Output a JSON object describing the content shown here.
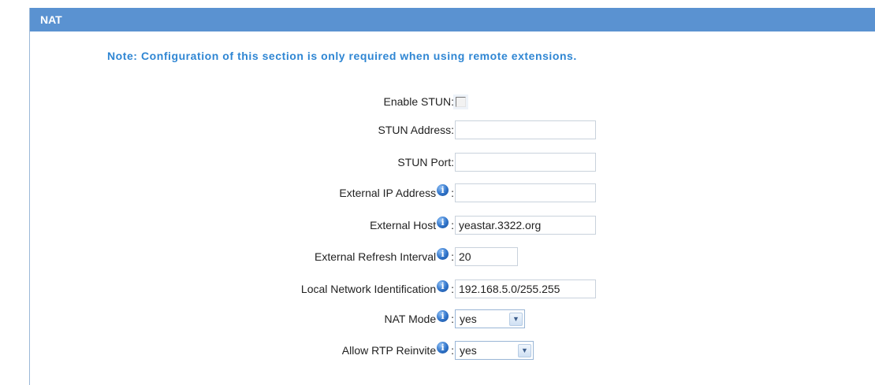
{
  "header": {
    "title": "NAT"
  },
  "note": "Note: Configuration of this section is only required when using remote extensions.",
  "form": {
    "enable_stun": {
      "label": "Enable STUN:",
      "checked": false
    },
    "stun_address": {
      "label": "STUN Address:",
      "value": ""
    },
    "stun_port": {
      "label": "STUN Port:",
      "value": ""
    },
    "external_ip": {
      "label": "External IP Address",
      "value": ""
    },
    "external_host": {
      "label": "External Host",
      "value": "yeastar.3322.org"
    },
    "external_refresh": {
      "label": "External Refresh Interval",
      "value": "20"
    },
    "local_network": {
      "label": "Local Network Identification",
      "value": "192.168.5.0/255.255"
    },
    "nat_mode": {
      "label": "NAT Mode",
      "selected": "yes"
    },
    "allow_rtp": {
      "label": "Allow RTP Reinvite",
      "selected": "yes"
    }
  },
  "icons": {
    "info": "info-icon",
    "dropdown": "chevron-down-icon"
  },
  "colors": {
    "header_bg": "#5a92d1",
    "note_text": "#2f86d3"
  }
}
